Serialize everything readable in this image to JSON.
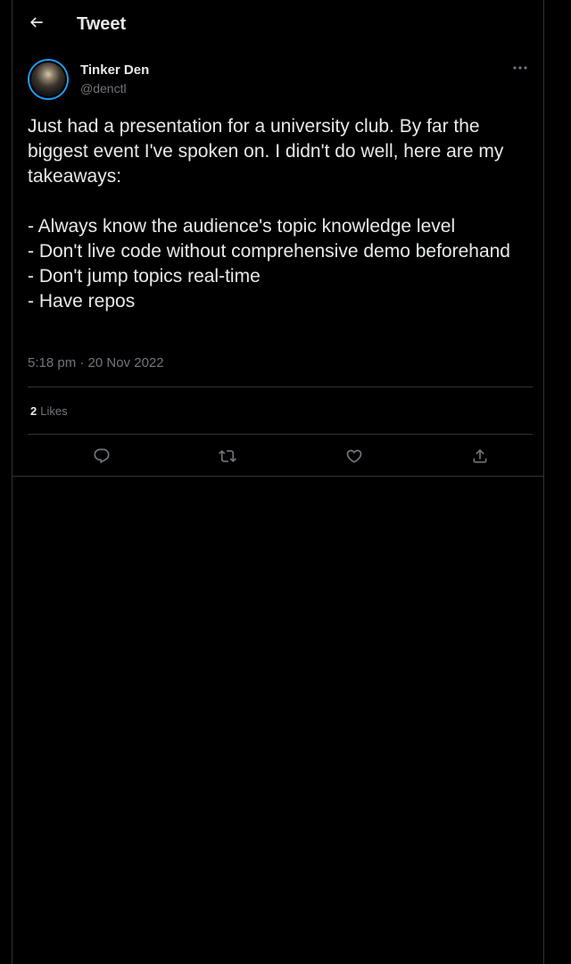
{
  "header": {
    "title": "Tweet",
    "back_icon": "arrow-left-icon"
  },
  "tweet": {
    "author": {
      "display_name": "Tinker Den",
      "handle": "@denctl"
    },
    "text": "Just had a presentation for a university club. By far the biggest event I've spoken on. I didn't do well, here are my takeaways:\n\n- Always know the audience's topic knowledge level\n- Don't live code without comprehensive demo beforehand\n- Don't jump topics real-time\n- Have repos",
    "timestamp": "5:18 pm · 20 Nov 2022",
    "likes_count": "2",
    "likes_label": "Likes",
    "actions": [
      "reply-icon",
      "retweet-icon",
      "like-icon",
      "share-icon"
    ]
  },
  "colors": {
    "background": "#000000",
    "text": "#e7e9ea",
    "secondary": "#71767b",
    "border": "#2f3336",
    "accent": "#1d9bf0"
  }
}
